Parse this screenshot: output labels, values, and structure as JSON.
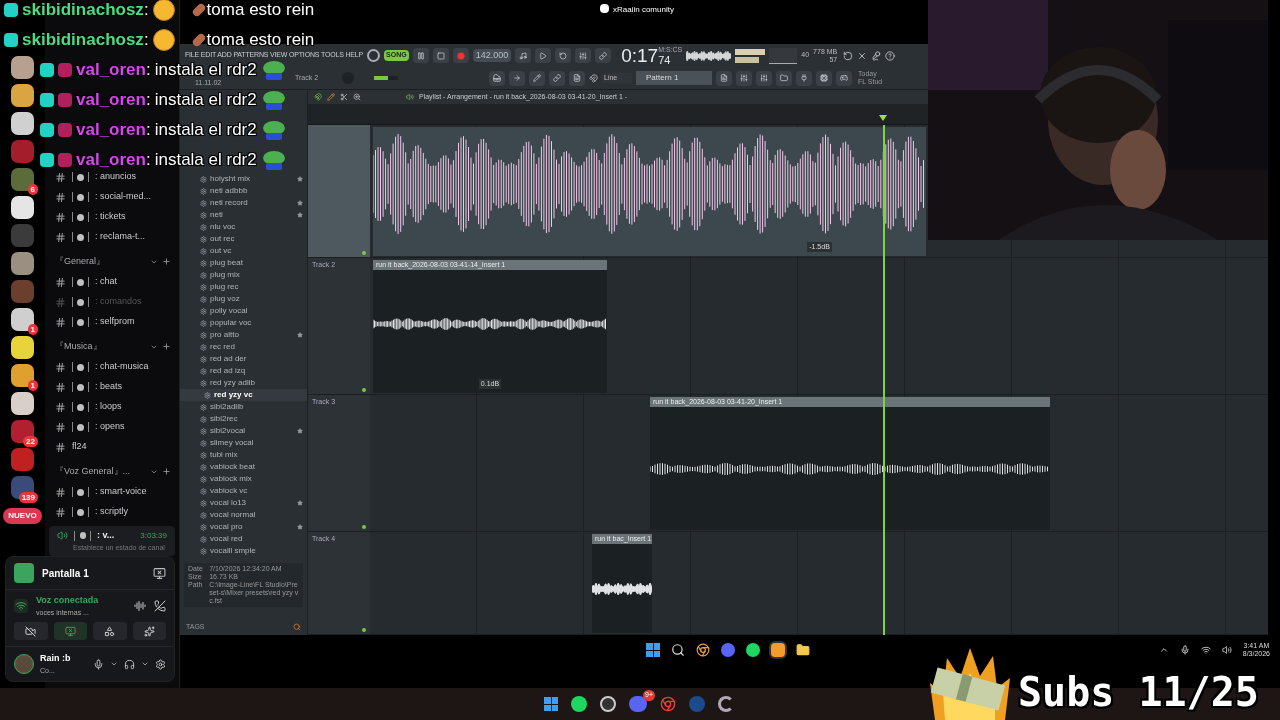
{
  "stream_title": "xRaaiin comunity",
  "chat": [
    {
      "kind": "emoji_first",
      "user": "skibidinachosz",
      "separator": ":",
      "message": "toma esto rein",
      "color": "#4ade80"
    },
    {
      "kind": "emoji_first",
      "user": "skibidinachosz",
      "separator": ":",
      "message": "toma esto rein",
      "color": "#4ade80"
    },
    {
      "kind": "emoji_last",
      "user": "val_oren",
      "separator": ":",
      "message": "instala el rdr2",
      "color": "#d946ef"
    },
    {
      "kind": "emoji_last",
      "user": "val_oren",
      "separator": ":",
      "message": "instala el rdr2",
      "color": "#d946ef"
    },
    {
      "kind": "emoji_last",
      "user": "val_oren",
      "separator": ":",
      "message": "instala el rdr2",
      "color": "#d946ef"
    },
    {
      "kind": "emoji_last",
      "user": "val_oren",
      "separator": ":",
      "message": "instala el rdr2",
      "color": "#d946ef"
    }
  ],
  "discord": {
    "servers": [
      {
        "kind": "plain"
      },
      {
        "kind": "plain"
      },
      {
        "kind": "plain"
      },
      {
        "kind": "plain"
      },
      {
        "kind": "badged",
        "badge": "6"
      },
      {
        "kind": "plain"
      },
      {
        "kind": "plain"
      },
      {
        "kind": "plain"
      },
      {
        "kind": "plain"
      },
      {
        "kind": "badged",
        "badge": "1"
      },
      {
        "kind": "plain"
      },
      {
        "kind": "badged",
        "badge": "1"
      },
      {
        "kind": "plain"
      },
      {
        "kind": "badged",
        "badge": "22"
      },
      {
        "kind": "plain"
      },
      {
        "kind": "badged",
        "badge": "139"
      }
    ],
    "new_label": "NUEVO",
    "channels": [
      {
        "kind": "text",
        "label": ": anuncios",
        "muted": false
      },
      {
        "kind": "text",
        "label": ": social-med...",
        "muted": false
      },
      {
        "kind": "text",
        "label": ": tickets",
        "muted": false
      },
      {
        "kind": "text",
        "label": ": reclama-t...",
        "muted": false
      },
      {
        "kind": "category",
        "label": "『General』",
        "muted": false
      },
      {
        "kind": "text",
        "label": ": chat",
        "muted": false
      },
      {
        "kind": "text",
        "label": ": comandos",
        "muted": true
      },
      {
        "kind": "text",
        "label": ": selfprom",
        "muted": false
      },
      {
        "kind": "category",
        "label": "『Musica』",
        "muted": false
      },
      {
        "kind": "text",
        "label": ": chat-musica",
        "muted": false
      },
      {
        "kind": "text",
        "label": ": beats",
        "muted": false
      },
      {
        "kind": "text",
        "label": ": loops",
        "muted": false
      },
      {
        "kind": "text",
        "label": ": opens",
        "muted": false
      },
      {
        "kind": "plain",
        "label": "fl24",
        "muted": false
      },
      {
        "kind": "category",
        "label": "『Voz General』...",
        "muted": false
      },
      {
        "kind": "text",
        "label": ": smart-voice",
        "muted": false
      },
      {
        "kind": "text",
        "label": ": scriptly",
        "muted": false
      }
    ],
    "voice_channel": {
      "label": ": v...",
      "time": "3:03:39",
      "status": "Establece un estado de canal"
    },
    "stream": {
      "title": "Pantalla 1"
    },
    "connection": {
      "title": "Voz conectada",
      "channel": "voces internas ..."
    },
    "user": {
      "name": "Rain :b",
      "status": "Co..."
    }
  },
  "fl": {
    "menu": "FILE EDIT ADD PATTERNS VIEW OPTIONS TOOLS HELP",
    "mode": "SONG",
    "tempo": "142.000",
    "time": "0:17",
    "time_cs": "74",
    "time_unit": "M:S:CS",
    "memory": "778 MB",
    "cpu": "57",
    "polyphony": "40",
    "snap": "Line",
    "pattern": "Pattern 1",
    "hint_time": "11.11.02",
    "hint_track": "Track 2",
    "news": [
      "Today",
      "FL Stud"
    ],
    "master_pitch": {
      "level": 0.6
    },
    "playlist_title": "Playlist - Arrangement - run it back_2026-08-03 03-41-20_Insert 1 -",
    "browser": [
      {
        "label": "holysht mix",
        "starred": true,
        "selected": false
      },
      {
        "label": "neti adbbb",
        "starred": false,
        "selected": false
      },
      {
        "label": "neti record",
        "starred": true,
        "selected": false
      },
      {
        "label": "neti",
        "starred": true,
        "selected": false
      },
      {
        "label": "nlu voc",
        "starred": false,
        "selected": false
      },
      {
        "label": "out rec",
        "starred": false,
        "selected": false
      },
      {
        "label": "out vc",
        "starred": false,
        "selected": false
      },
      {
        "label": "plug beat",
        "starred": false,
        "selected": false
      },
      {
        "label": "plug mix",
        "starred": false,
        "selected": false
      },
      {
        "label": "plug rec",
        "starred": false,
        "selected": false
      },
      {
        "label": "plug voz",
        "starred": false,
        "selected": false
      },
      {
        "label": "polly vocal",
        "starred": false,
        "selected": false
      },
      {
        "label": "popular voc",
        "starred": false,
        "selected": false
      },
      {
        "label": "pro altto",
        "starred": true,
        "selected": false
      },
      {
        "label": "rec red",
        "starred": false,
        "selected": false
      },
      {
        "label": "red ad der",
        "starred": false,
        "selected": false
      },
      {
        "label": "red ad izq",
        "starred": false,
        "selected": false
      },
      {
        "label": "red yzy adlib",
        "starred": false,
        "selected": false
      },
      {
        "label": "red yzy vc",
        "starred": false,
        "selected": true
      },
      {
        "label": "sibi2adlib",
        "starred": false,
        "selected": false
      },
      {
        "label": "sibi2rec",
        "starred": false,
        "selected": false
      },
      {
        "label": "sibi2vocal",
        "starred": true,
        "selected": false
      },
      {
        "label": "slimey vocal",
        "starred": false,
        "selected": false
      },
      {
        "label": "tubi mix",
        "starred": false,
        "selected": false
      },
      {
        "label": "vablock beat",
        "starred": false,
        "selected": false
      },
      {
        "label": "vablock mix",
        "starred": false,
        "selected": false
      },
      {
        "label": "vablock vc",
        "starred": false,
        "selected": false
      },
      {
        "label": "vocal lo13",
        "starred": true,
        "selected": false
      },
      {
        "label": "vocal normal",
        "starred": false,
        "selected": false
      },
      {
        "label": "vocal pro",
        "starred": true,
        "selected": false
      },
      {
        "label": "vocal red",
        "starred": false,
        "selected": false
      },
      {
        "label": "vocalll smple",
        "starred": false,
        "selected": false
      }
    ],
    "info": [
      {
        "key": "Date",
        "value": "7/10/2026 12:34:20 AM"
      },
      {
        "key": "Size",
        "value": "16.73 KB"
      },
      {
        "key": "Path",
        "value": "C:\\Image-Line\\FL Studio\\Preset-s\\Mixer presets\\red yzy vc.fst"
      }
    ],
    "tags_label": "TAGS",
    "tracks": [
      {
        "reading": "-1.5dB",
        "kind": "loud"
      },
      {
        "label": "Track 2",
        "clip": "run it back_2026-08-03 03-41-14_Insert 1",
        "reading": "0.1dB",
        "kind": "quiet"
      },
      {
        "label": "Track 3",
        "clip": "run it back_2026-08-03 03-41-20_Insert 1",
        "kind": "quiet"
      },
      {
        "label": "Track 4",
        "clip": "run it bac_Insert 1",
        "kind": "quiet"
      }
    ]
  },
  "taskbar": {
    "time": "3:41 AM",
    "date": "8/3/2026"
  },
  "outer_taskbar": {
    "discord_badge": "9+"
  },
  "subs": "Subs 11/25"
}
